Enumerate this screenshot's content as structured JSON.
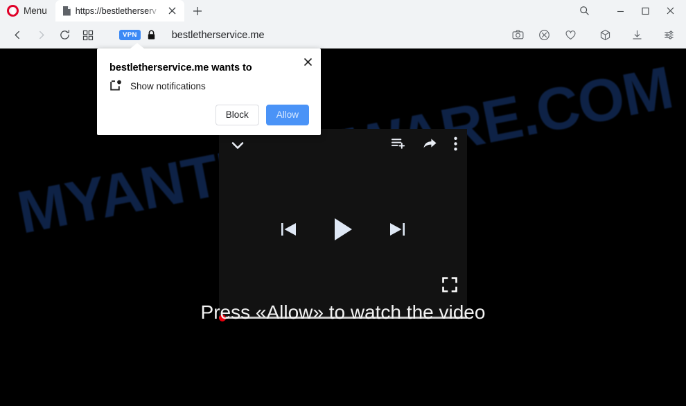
{
  "browser": {
    "name": "Opera",
    "menu_label": "Menu",
    "tab": {
      "title": "https://bestletherserv",
      "favicon_name": "page-icon",
      "close_label": "×"
    },
    "new_tab_label": "+",
    "window_controls": {
      "search": "search-icon",
      "minimize": "minimize-icon",
      "maximize": "maximize-icon",
      "close": "close-icon"
    },
    "toolbar": {
      "back": "back-arrow-icon",
      "forward": "forward-arrow-icon",
      "reload": "reload-icon",
      "speeddial": "grid-icon",
      "vpn_badge": "VPN",
      "lock": "padlock-icon",
      "url": "bestletherservice.me",
      "right_icons": [
        "snapshot-camera-icon",
        "ad-blocker-shield-icon",
        "heart-icon",
        "cube-icon",
        "download-icon",
        "easy-setup-sliders-icon"
      ]
    }
  },
  "popup": {
    "title": "bestletherservice.me wants to",
    "permission": "Show notifications",
    "icon_name": "notification-badge-icon",
    "block_label": "Block",
    "allow_label": "Allow",
    "close_label": "×",
    "allow_color": "#4a93f7"
  },
  "page": {
    "watermark": "MYANTISPYWARE.COM",
    "watermark_color": "#0e2246",
    "background": "#000000",
    "headline": "Press «Allow» to watch the video",
    "player": {
      "background": "#121212",
      "collapse_icon": "chevron-down-icon",
      "playlist_add_icon": "playlist-add-icon",
      "share_icon": "share-arrow-icon",
      "more_icon": "kebab-menu-icon",
      "previous_icon": "skip-previous-icon",
      "play_icon": "play-icon",
      "next_icon": "skip-next-icon",
      "fullscreen_icon": "fullscreen-icon",
      "progress_percent": 0,
      "progress_dot_color": "#e8000d",
      "seek_bar_color": "#c9c9c9"
    }
  }
}
